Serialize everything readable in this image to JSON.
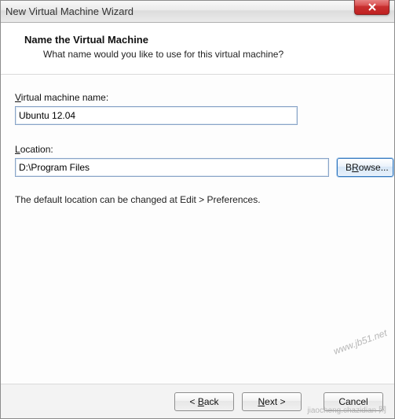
{
  "window": {
    "title": "New Virtual Machine Wizard"
  },
  "banner": {
    "title": "Name the Virtual Machine",
    "subtitle": "What name would you like to use for this virtual machine?"
  },
  "fields": {
    "vm_name": {
      "label_prefix": "V",
      "label_rest": "irtual machine name:",
      "value": "Ubuntu 12.04"
    },
    "location": {
      "label_prefix": "L",
      "label_rest": "ocation:",
      "value": "D:\\Program Files",
      "browse_accel": "R",
      "browse_prefix": "B",
      "browse_rest": "owse..."
    }
  },
  "note": "The default location can be changed at Edit > Preferences.",
  "buttons": {
    "back": {
      "lt": "< ",
      "accel": "B",
      "rest": "ack"
    },
    "next": {
      "accel": "N",
      "rest": "ext >"
    },
    "cancel": {
      "text": "Cancel"
    }
  },
  "watermark": {
    "main": "www.jb51.net",
    "sub": "jiaocheng.chazidian 网"
  }
}
